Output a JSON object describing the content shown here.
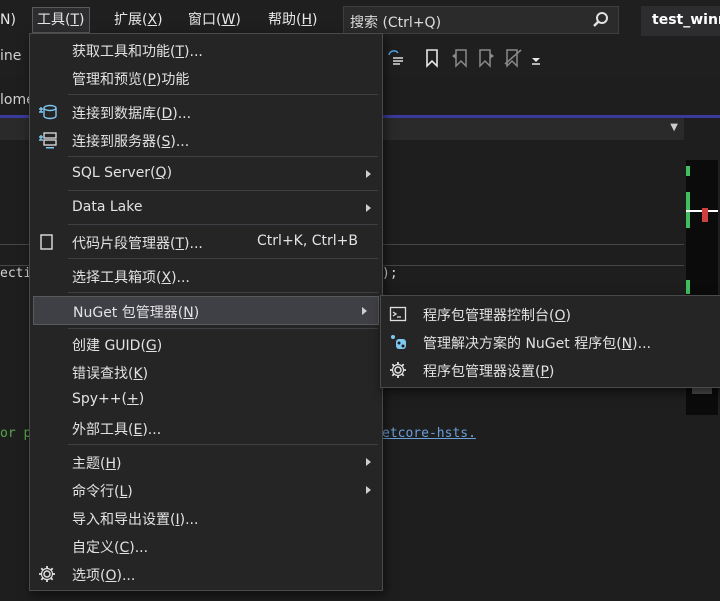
{
  "menubar": {
    "items": [
      {
        "label": "N)",
        "underline": "N"
      },
      {
        "label": "工具(T)",
        "underline": "T"
      },
      {
        "label": "扩展(X)",
        "underline": "X"
      },
      {
        "label": "窗口(W)",
        "underline": "W"
      },
      {
        "label": "帮助(H)",
        "underline": "H"
      }
    ],
    "search_placeholder": "搜索 (Ctrl+Q)",
    "title": "test_winr"
  },
  "toolbar": {
    "partial_label": "ine"
  },
  "tabrow": {
    "partial_label": "lome"
  },
  "code": {
    "line1": "ecti",
    "line1_end": ");",
    "line2": "or p",
    "line2_end": "etcore-hsts."
  },
  "tools_menu": {
    "items": [
      {
        "label": "获取工具和功能(T)...",
        "shortcut": ""
      },
      {
        "label": "管理和预览(P)功能",
        "shortcut": ""
      },
      {
        "label": "连接到数据库(D)...",
        "shortcut": ""
      },
      {
        "label": "连接到服务器(S)...",
        "shortcut": ""
      },
      {
        "label": "SQL Server(Q)",
        "shortcut": ""
      },
      {
        "label": "Data Lake",
        "shortcut": ""
      },
      {
        "label": "代码片段管理器(T)...",
        "shortcut": "Ctrl+K, Ctrl+B"
      },
      {
        "label": "选择工具箱项(X)...",
        "shortcut": ""
      },
      {
        "label": "NuGet 包管理器(N)",
        "shortcut": ""
      },
      {
        "label": "创建 GUID(G)",
        "shortcut": ""
      },
      {
        "label": "错误查找(K)",
        "shortcut": ""
      },
      {
        "label": "Spy++(+)",
        "shortcut": ""
      },
      {
        "label": "外部工具(E)...",
        "shortcut": ""
      },
      {
        "label": "主题(H)",
        "shortcut": ""
      },
      {
        "label": "命令行(L)",
        "shortcut": ""
      },
      {
        "label": "导入和导出设置(I)...",
        "shortcut": ""
      },
      {
        "label": "自定义(C)...",
        "shortcut": ""
      },
      {
        "label": "选项(O)...",
        "shortcut": ""
      }
    ]
  },
  "nuget_submenu": {
    "items": [
      {
        "label": "程序包管理器控制台(O)"
      },
      {
        "label": "管理解决方案的 NuGet 程序包(N)..."
      },
      {
        "label": "程序包管理器设置(P)"
      }
    ]
  },
  "colors": {
    "accent": "#3a3a9a",
    "menu_bg": "#252526",
    "highlight": "#3f3f46"
  }
}
